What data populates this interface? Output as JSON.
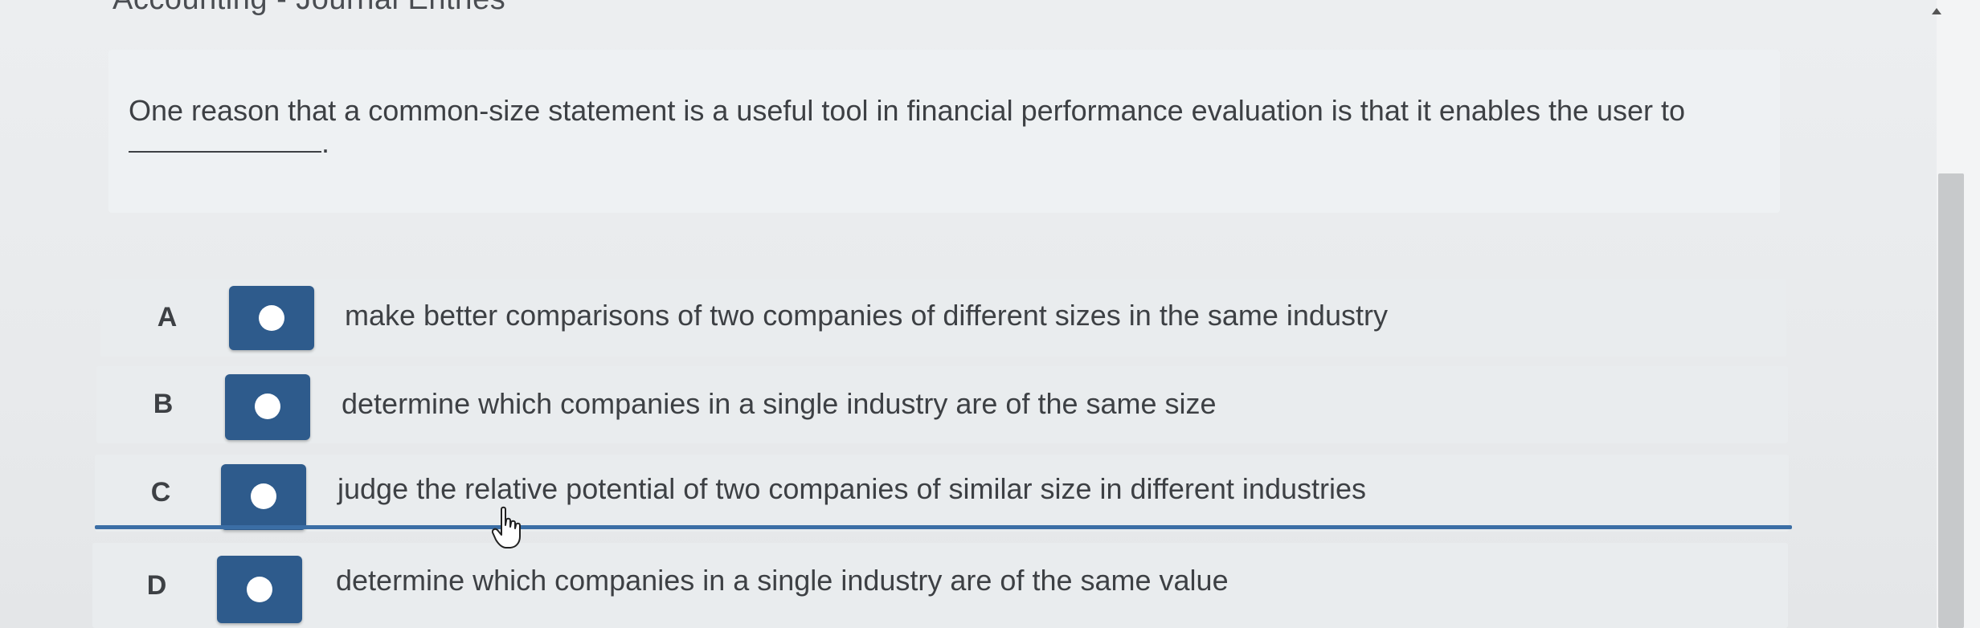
{
  "header": {
    "title": "Accounting - Journal Entries"
  },
  "question": {
    "text": "One reason that a common-size statement is a useful tool in financial performance evaluation is that it enables the user to",
    "suffix": "."
  },
  "options": [
    {
      "letter": "A",
      "text": "make better comparisons of two companies of different sizes in the same industry"
    },
    {
      "letter": "B",
      "text": "determine which companies in a single industry are of the same size"
    },
    {
      "letter": "C",
      "text": "judge the relative potential of two companies of similar size in different industries"
    },
    {
      "letter": "D",
      "text": "determine which companies in a single industry are of the same value"
    }
  ],
  "colors": {
    "radio_bg": "#2e5b8c",
    "hover_line": "#3b6ea5",
    "text": "#3d4044"
  },
  "icons": {
    "cursor": "hand-pointer-icon",
    "scroll_up": "chevron-up-icon"
  }
}
